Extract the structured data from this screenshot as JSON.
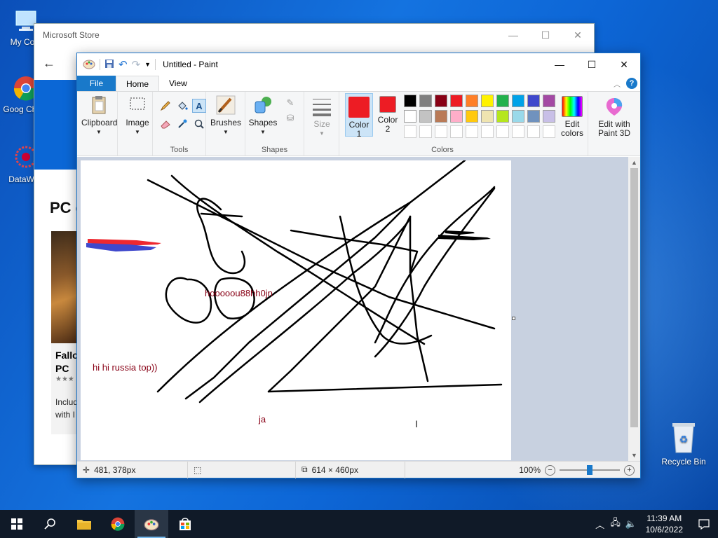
{
  "desktop": {
    "icons": [
      {
        "label": "My Com"
      },
      {
        "label": "Goog Chron"
      },
      {
        "label": "DataWag"
      }
    ],
    "recycle_bin": "Recycle Bin"
  },
  "store": {
    "title": "Microsoft Store",
    "heading": "PC g",
    "card_title": "Fallo PC",
    "card_desc": "Includ with I"
  },
  "paint": {
    "title": "Untitled - Paint",
    "tabs": {
      "file": "File",
      "home": "Home",
      "view": "View"
    },
    "ribbon": {
      "clipboard": "Clipboard",
      "image": "Image",
      "tools": "Tools",
      "brushes": "Brushes",
      "shapes": "Shapes",
      "shapes_group": "Shapes",
      "size": "Size",
      "color1": "Color 1",
      "color2": "Color 2",
      "colors_group": "Colors",
      "edit_colors": "Edit colors",
      "edit_paint3d": "Edit with Paint 3D"
    },
    "palette_row1": [
      "#000000",
      "#7f7f7f",
      "#880015",
      "#ed1c24",
      "#ff7f27",
      "#fff200",
      "#22b14c",
      "#00a2e8",
      "#3f48cc",
      "#a349a4"
    ],
    "palette_row2": [
      "#ffffff",
      "#c3c3c3",
      "#b97a57",
      "#ffaec9",
      "#ffc90e",
      "#efe4b0",
      "#b5e61d",
      "#99d9ea",
      "#7092be",
      "#c8bfe7"
    ],
    "color1_value": "#ed1c24",
    "color2_value": "#ed1c24",
    "canvas_texts": {
      "t1": "hooooou88hh0jn",
      "t2": "hi hi russia top))",
      "t3": "ja"
    },
    "status": {
      "cursor_pos": "481, 378px",
      "image_size": "614 × 460px",
      "zoom": "100%"
    }
  },
  "taskbar": {
    "time": "11:39 AM",
    "date": "10/6/2022"
  }
}
